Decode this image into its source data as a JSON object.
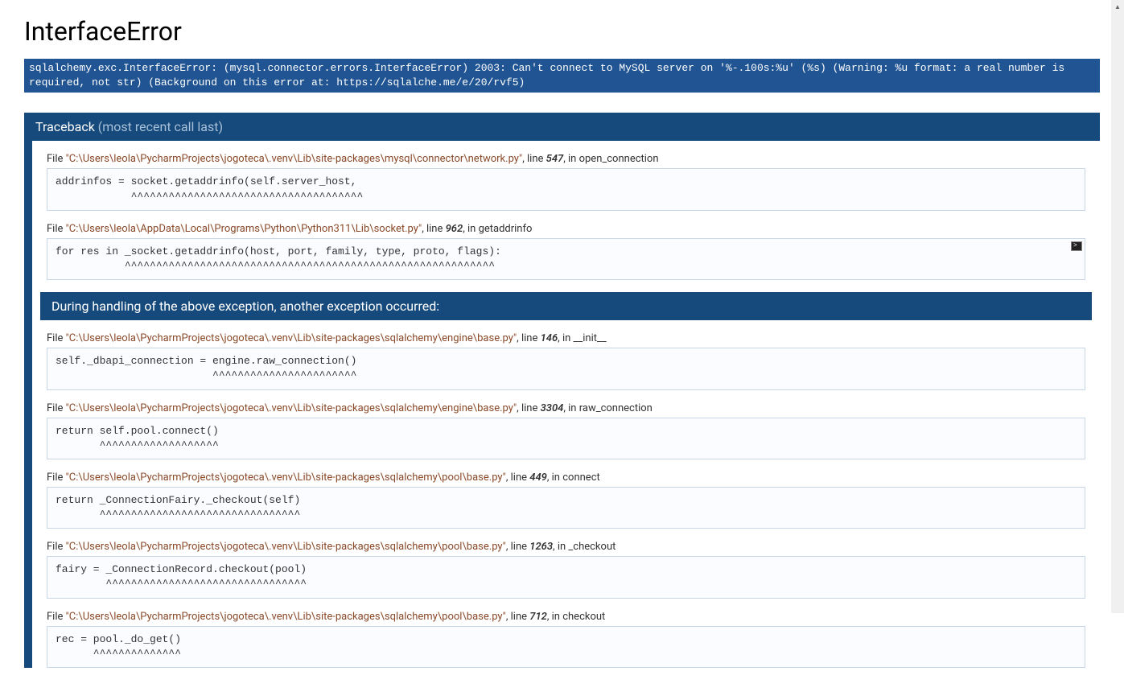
{
  "title": "InterfaceError",
  "error_message": "sqlalchemy.exc.InterfaceError: (mysql.connector.errors.InterfaceError) 2003: Can't connect to MySQL server on '%-.100s:%u' (%s) (Warning: %u format: a real number is required, not str)\n(Background on this error at: https://sqlalche.me/e/20/rvf5)",
  "traceback_title": "Traceback",
  "traceback_sub": "(most recent call last)",
  "frames1": [
    {
      "path": "\"C:\\Users\\leola\\PycharmProjects\\jogoteca\\.venv\\Lib\\site-packages\\mysql\\connector\\network.py\"",
      "lineno": "547",
      "func": "open_connection",
      "code": "addrinfos = socket.getaddrinfo(self.server_host,\n            ^^^^^^^^^^^^^^^^^^^^^^^^^^^^^^^^^^^^^"
    },
    {
      "path": "\"C:\\Users\\leola\\AppData\\Local\\Programs\\Python\\Python311\\Lib\\socket.py\"",
      "lineno": "962",
      "func": "getaddrinfo",
      "code": "for res in _socket.getaddrinfo(host, port, family, type, proto, flags):\n           ^^^^^^^^^^^^^^^^^^^^^^^^^^^^^^^^^^^^^^^^^^^^^^^^^^^^^^^^^^^",
      "console": true
    }
  ],
  "context_banner": "During handling of the above exception, another exception occurred:",
  "frames2": [
    {
      "path": "\"C:\\Users\\leola\\PycharmProjects\\jogoteca\\.venv\\Lib\\site-packages\\sqlalchemy\\engine\\base.py\"",
      "lineno": "146",
      "func": "__init__",
      "code": "self._dbapi_connection = engine.raw_connection()\n                         ^^^^^^^^^^^^^^^^^^^^^^^"
    },
    {
      "path": "\"C:\\Users\\leola\\PycharmProjects\\jogoteca\\.venv\\Lib\\site-packages\\sqlalchemy\\engine\\base.py\"",
      "lineno": "3304",
      "func": "raw_connection",
      "code": "return self.pool.connect()\n       ^^^^^^^^^^^^^^^^^^^"
    },
    {
      "path": "\"C:\\Users\\leola\\PycharmProjects\\jogoteca\\.venv\\Lib\\site-packages\\sqlalchemy\\pool\\base.py\"",
      "lineno": "449",
      "func": "connect",
      "code": "return _ConnectionFairy._checkout(self)\n       ^^^^^^^^^^^^^^^^^^^^^^^^^^^^^^^^"
    },
    {
      "path": "\"C:\\Users\\leola\\PycharmProjects\\jogoteca\\.venv\\Lib\\site-packages\\sqlalchemy\\pool\\base.py\"",
      "lineno": "1263",
      "func": "_checkout",
      "code": "fairy = _ConnectionRecord.checkout(pool)\n        ^^^^^^^^^^^^^^^^^^^^^^^^^^^^^^^^"
    },
    {
      "path": "\"C:\\Users\\leola\\PycharmProjects\\jogoteca\\.venv\\Lib\\site-packages\\sqlalchemy\\pool\\base.py\"",
      "lineno": "712",
      "func": "checkout",
      "code": "rec = pool._do_get()\n      ^^^^^^^^^^^^^^"
    }
  ],
  "labels": {
    "file": "File ",
    "line": ", line ",
    "in": ", in "
  }
}
